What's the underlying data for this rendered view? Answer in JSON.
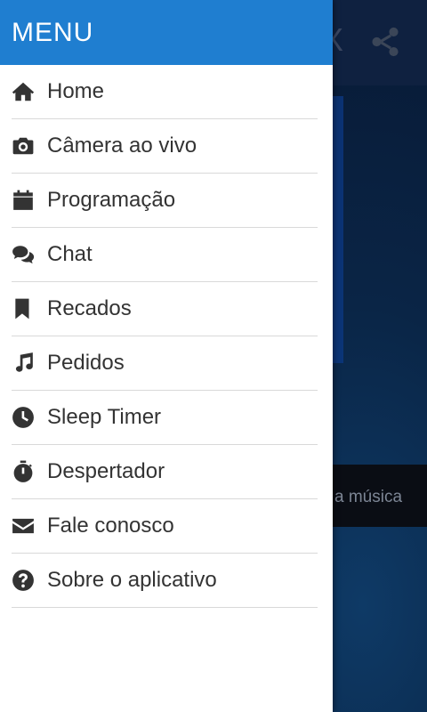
{
  "drawer": {
    "title": "MENU",
    "items": [
      {
        "label": "Home",
        "icon": "home-icon"
      },
      {
        "label": "Câmera ao vivo",
        "icon": "camera-icon"
      },
      {
        "label": "Programação",
        "icon": "calendar-icon"
      },
      {
        "label": "Chat",
        "icon": "chat-icon"
      },
      {
        "label": "Recados",
        "icon": "bookmark-icon"
      },
      {
        "label": "Pedidos",
        "icon": "music-icon"
      },
      {
        "label": "Sleep Timer",
        "icon": "clock-icon"
      },
      {
        "label": "Despertador",
        "icon": "stopwatch-icon"
      },
      {
        "label": "Fale conosco",
        "icon": "envelope-icon"
      },
      {
        "label": "Sobre o aplicativo",
        "icon": "question-icon"
      }
    ]
  },
  "background": {
    "now_playing_partial": "a música",
    "header_partial": "X",
    "share_icon": "share-icon"
  },
  "colors": {
    "header": "#1f7ed0",
    "text": "#333333",
    "divider": "#d9d9d9"
  }
}
